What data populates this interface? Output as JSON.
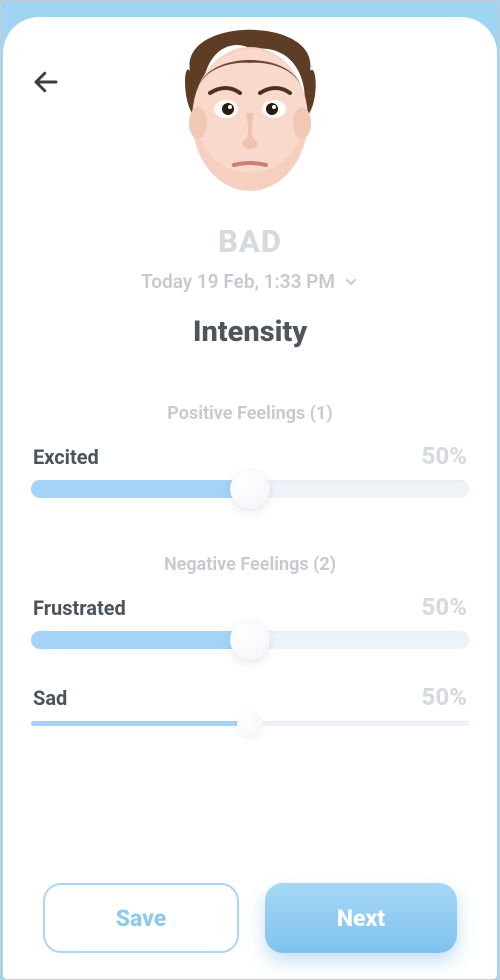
{
  "mood": {
    "label": "BAD"
  },
  "date": {
    "text": "Today 19 Feb, 1:33 PM"
  },
  "section": {
    "title": "Intensity"
  },
  "groups": {
    "positive": {
      "heading": "Positive Feelings (1)"
    },
    "negative": {
      "heading": "Negative Feelings (2)"
    }
  },
  "sliders": {
    "excited": {
      "name": "Excited",
      "pct_label": "50%",
      "value": 50
    },
    "frustrated": {
      "name": "Frustrated",
      "pct_label": "50%",
      "value": 50
    },
    "sad": {
      "name": "Sad",
      "pct_label": "50%",
      "value": 50
    }
  },
  "footer": {
    "save_label": "Save",
    "next_label": "Next"
  },
  "colors": {
    "accent": "#8dc9f2",
    "track": "#eef3f8",
    "text_muted": "#c7cbd0"
  }
}
